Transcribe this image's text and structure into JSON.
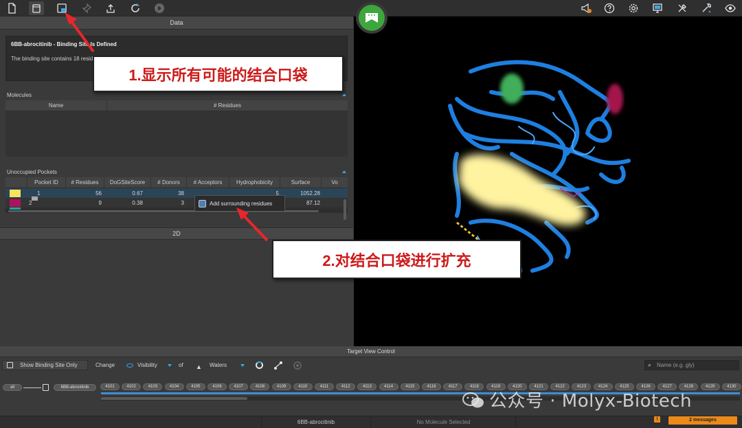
{
  "toolbar": {
    "left_icons": [
      "document-icon",
      "database-icon",
      "binding-site-icon",
      "pin-icon",
      "upload-icon",
      "refresh-icon",
      "play-icon"
    ],
    "right_icons": [
      "announce-icon",
      "help-icon",
      "settings-icon",
      "monitor-icon",
      "tools-icon",
      "wrench-icon",
      "eye-icon"
    ]
  },
  "data_panel": {
    "title": "Data",
    "info_title": "6BB-abrocitinib - Binding Site Is Defined",
    "info_text": "The binding site contains 18 residues and is ready to use for calculations."
  },
  "molecules": {
    "title": "Molecules",
    "columns": [
      "Name",
      "# Residues"
    ]
  },
  "pockets": {
    "title": "Unoccupied Pockets",
    "columns": [
      "Pocket ID",
      "# Residues",
      "DoGSiteScore",
      "# Donors",
      "# Acceptors",
      "Hydrophobicity",
      "Surface",
      "Vo"
    ],
    "rows": [
      {
        "color": "#f5e35c",
        "id": "1",
        "residues": "56",
        "score": "0.67",
        "donors": "38",
        "acceptors": "",
        "hydro": "5",
        "surface": "1052.28"
      },
      {
        "color": "#b01060",
        "id": "2",
        "residues": "9",
        "score": "0.38",
        "donors": "3",
        "acceptors": "",
        "hydro": "2",
        "surface": "87.12"
      }
    ]
  },
  "tooltip": {
    "label": "Add surrounding residues"
  },
  "twod": {
    "title": "2D"
  },
  "callouts": {
    "one": "1.显示所有可能的结合口袋",
    "two": "2.对结合口袋进行扩充"
  },
  "target_view": {
    "title": "Target View Control",
    "show_binding_site": "Show Binding Site Only",
    "change_label": "Change",
    "visibility": "Visibility",
    "of_label": "of",
    "waters": "Waters",
    "search_placeholder": "Name (e.g. gly)"
  },
  "chain": {
    "all_label": "all",
    "molecule": "6BB-abrocitinib",
    "residues": [
      "4101",
      "4102",
      "4103",
      "4104",
      "4105",
      "4106",
      "4107",
      "4108",
      "4109",
      "4110",
      "4111",
      "4112",
      "4113",
      "4114",
      "4115",
      "4116",
      "4117",
      "4118",
      "4119",
      "4120",
      "4121",
      "4122",
      "4123",
      "4124",
      "4125",
      "4126",
      "4127",
      "4128",
      "4129",
      "4130"
    ]
  },
  "status": {
    "molecule": "6BB-abrocitinib",
    "selection": "No Molecule Selected",
    "warn": "!",
    "messages": "2 messages"
  },
  "watermark": "公众号 · Molyx-Biotech"
}
